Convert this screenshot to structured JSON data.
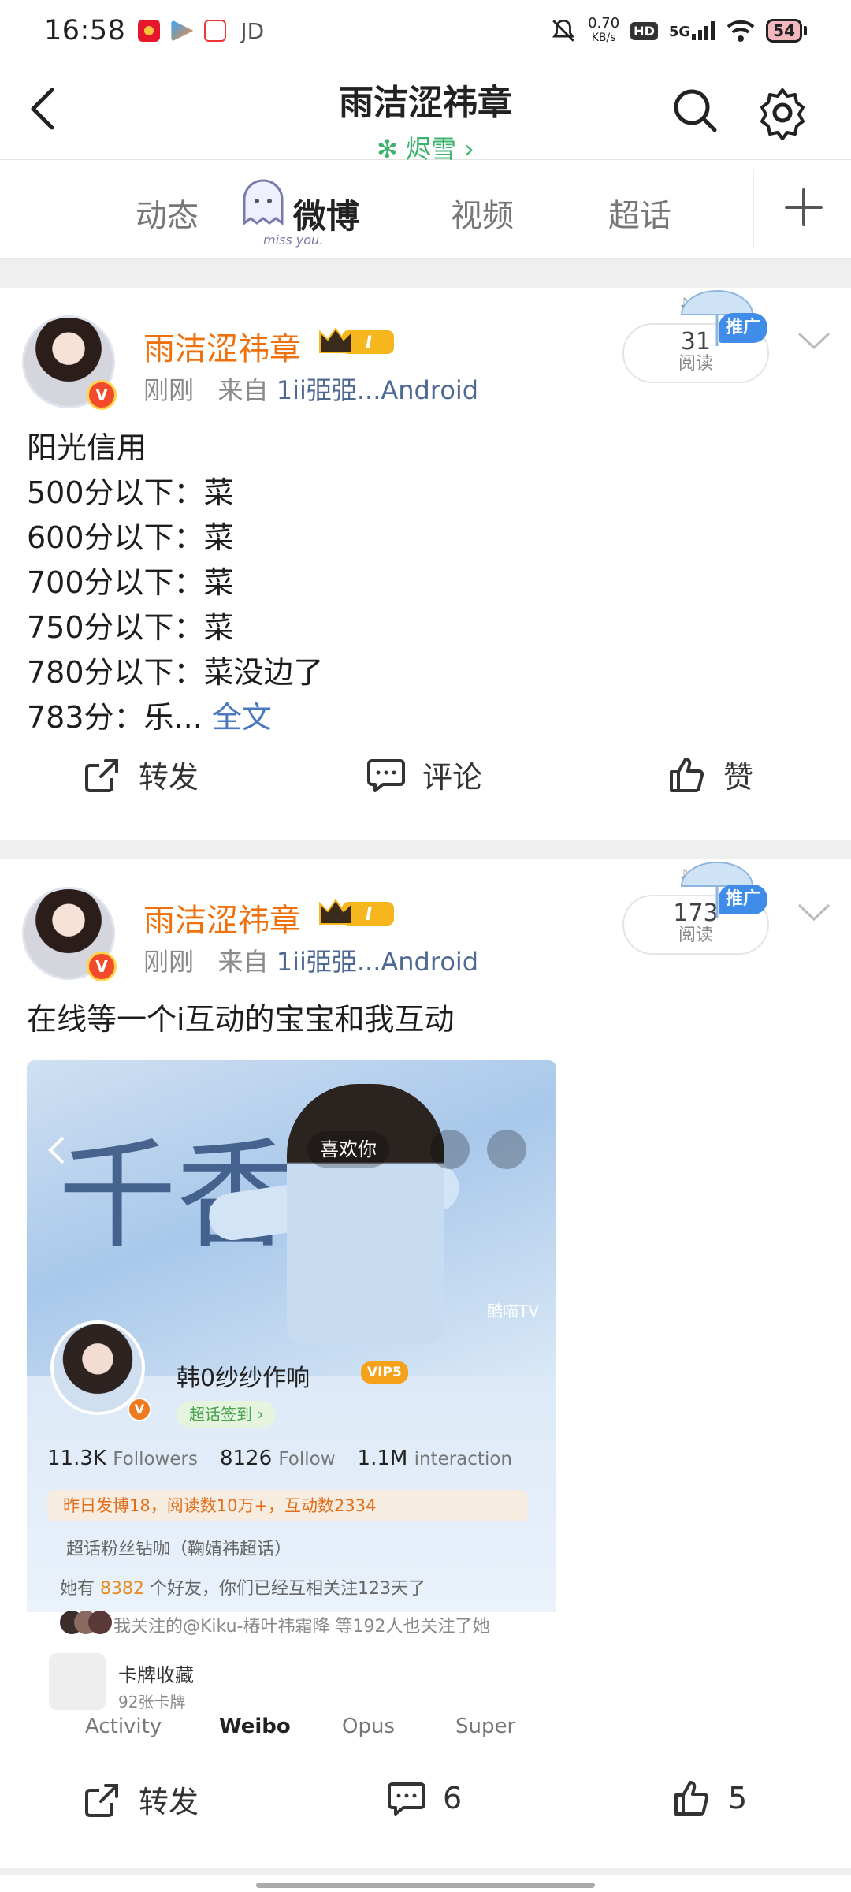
{
  "status_bar": {
    "time": "16:58",
    "carrier_app": "JD",
    "net_speed_value": "0.70",
    "net_speed_unit": "KB/s",
    "hd": "HD",
    "signal": "5G",
    "battery": "54"
  },
  "header": {
    "title": "雨洁涩祎章",
    "subtitle": "✻ 烬雪 ›"
  },
  "tabs": {
    "items": [
      "动态",
      "微博",
      "视频",
      "超话"
    ],
    "active": "微博",
    "deco_text": "miss you."
  },
  "posts": [
    {
      "username": "雨洁涩祎章",
      "level_badge": "I",
      "meta_time": "刚刚",
      "meta_from": "来自",
      "meta_source": "1ii弫弫...Android",
      "reads_count": "31",
      "reads_label": "阅读",
      "promo_label": "推广",
      "body_lines": [
        "阳光信用",
        "500分以下：菜",
        "600分以下：菜",
        "700分以下：菜",
        "750分以下：菜",
        "780分以下：菜没边了"
      ],
      "last_line": "783分：乐...",
      "fulltext": "全文",
      "actions": {
        "repost": "转发",
        "comment": "评论",
        "like": "赞"
      }
    },
    {
      "username": "雨洁涩祎章",
      "level_badge": "I",
      "meta_time": "刚刚",
      "meta_from": "来自",
      "meta_source": "1ii弫弫...Android",
      "reads_count": "173",
      "reads_label": "阅读",
      "promo_label": "推广",
      "body_text": "在线等一个i互动的宝宝和我互动",
      "actions": {
        "repost": "转发",
        "comment": "6",
        "like": "5"
      }
    }
  ],
  "embedded_screenshot": {
    "calligraphy": "千香",
    "like_pill": "喜欢你",
    "tv_logo": "酷喵TV",
    "profile_name": "韩0纱纱作响",
    "vip_badge": "VIP5",
    "checkin": "超话签到 ›",
    "followers_num": "11.3K",
    "followers_lbl": "Followers",
    "follow_num": "8126",
    "follow_lbl": "Follow",
    "interaction_num": "1.1M",
    "interaction_lbl": "interaction",
    "activity_strip": "昨日发博18，阅读数10万+，互动数2334",
    "fan_level": "超话粉丝钻咖（鞠婧祎超话）",
    "friends_pre": "她有",
    "friends_count": "8382",
    "friends_post": "个好友，你们已经互相关注123天了",
    "mutual": "我关注的@Kiku-椿叶祎霜降 等192人也关注了她",
    "card_title": "卡牌收藏",
    "card_sub": "92张卡牌",
    "tabs": [
      "Activity",
      "Weibo",
      "Opus",
      "Super"
    ]
  },
  "colors": {
    "accent_orange": "#f0700c",
    "link_blue": "#4a78c0",
    "green": "#3bb36d",
    "promo_blue": "#3f8de8"
  }
}
